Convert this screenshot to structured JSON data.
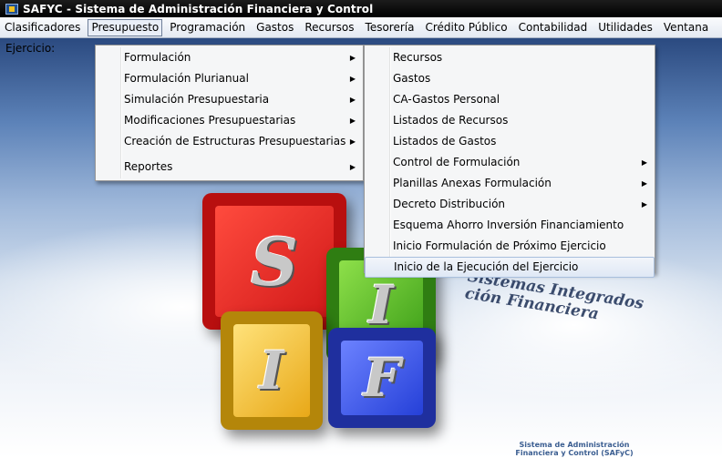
{
  "window": {
    "title": "SAFYC - Sistema de Administración Financiera y Control"
  },
  "menubar": {
    "items": [
      "Clasificadores",
      "Presupuesto",
      "Programación",
      "Gastos",
      "Recursos",
      "Tesorería",
      "Crédito Público",
      "Contabilidad",
      "Utilidades",
      "Ventana"
    ],
    "active_index": 1
  },
  "main": {
    "ejercicio_label": "Ejercicio:"
  },
  "menu_presupuesto": {
    "items": [
      {
        "label": "Formulación",
        "submenu": true
      },
      {
        "label": "Formulación Plurianual",
        "submenu": true
      },
      {
        "label": "Simulación Presupuestaria",
        "submenu": true
      },
      {
        "label": "Modificaciones Presupuestarias",
        "submenu": true
      },
      {
        "label": "Creación de Estructuras Presupuestarias",
        "submenu": true
      },
      {
        "label": "Reportes",
        "submenu": true
      }
    ]
  },
  "menu_formulacion": {
    "items": [
      {
        "label": "Recursos",
        "submenu": false
      },
      {
        "label": "Gastos",
        "submenu": false
      },
      {
        "label": "CA-Gastos Personal",
        "submenu": false
      },
      {
        "label": "Listados de Recursos",
        "submenu": false
      },
      {
        "label": "Listados de Gastos",
        "submenu": false
      },
      {
        "label": "Control de Formulación",
        "submenu": true
      },
      {
        "label": "Planillas Anexas Formulación",
        "submenu": true
      },
      {
        "label": "Decreto Distribución",
        "submenu": true
      },
      {
        "label": "Esquema Ahorro Inversión Financiamiento",
        "submenu": false
      },
      {
        "label": "Inicio Formulación de Próximo Ejercicio",
        "submenu": false
      },
      {
        "label": "Inicio de la Ejecución del Ejercicio",
        "submenu": false
      }
    ],
    "highlighted_index": 10
  },
  "logo": {
    "letters": [
      "S",
      "I",
      "I",
      "F"
    ],
    "tagline": [
      "Sistemas Integrados",
      "de Administración Financiera"
    ],
    "tagline_visible": [
      "Sistemas Integrados",
      "ción Financiera"
    ],
    "footer": [
      "Sistema de Administración",
      "Financiera y Control (SAFyC)"
    ]
  },
  "icons": {
    "submenu_arrow": "▶"
  }
}
